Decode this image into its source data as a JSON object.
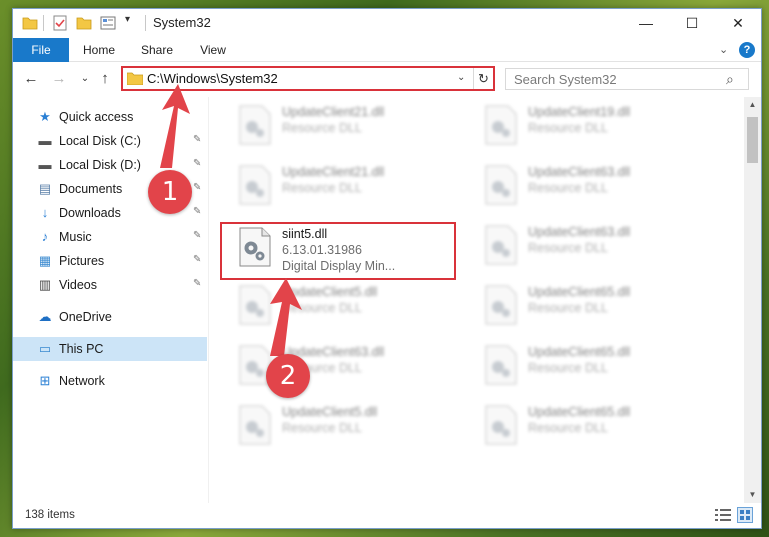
{
  "window": {
    "title": "System32",
    "quick_access_icons": [
      "folder-icon",
      "checklist-icon",
      "new-folder-icon",
      "properties-icon",
      "customize-arrow-icon"
    ],
    "controls": {
      "minimize": "—",
      "maximize": "☐",
      "close": "✕"
    }
  },
  "ribbon": {
    "tabs": [
      "File",
      "Home",
      "Share",
      "View"
    ],
    "expand": "⌄",
    "help": "?"
  },
  "nav": {
    "back": "←",
    "forward": "→",
    "recent": "⌄",
    "up": "↑"
  },
  "address": {
    "path": "C:\\Windows\\System32",
    "dropdown": "⌄",
    "refresh": "↻"
  },
  "search": {
    "placeholder": "Search System32",
    "icon": "⌕"
  },
  "sidebar": {
    "items": [
      {
        "label": "Quick access",
        "icon": "★",
        "pinned": false
      },
      {
        "label": "Local Disk (C:)",
        "icon": "▬",
        "pinned": true
      },
      {
        "label": "Local Disk (D:)",
        "icon": "▬",
        "pinned": true
      },
      {
        "label": "Documents",
        "icon": "▤",
        "pinned": true
      },
      {
        "label": "Downloads",
        "icon": "↓",
        "pinned": true
      },
      {
        "label": "Music",
        "icon": "♪",
        "pinned": true
      },
      {
        "label": "Pictures",
        "icon": "▦",
        "pinned": true
      },
      {
        "label": "Videos",
        "icon": "▥",
        "pinned": true
      },
      {
        "label": "OneDrive",
        "icon": "☁",
        "pinned": false
      },
      {
        "label": "This PC",
        "icon": "▭",
        "pinned": false
      },
      {
        "label": "Network",
        "icon": "⊞",
        "pinned": false
      }
    ],
    "pin_glyph": "✎"
  },
  "files": {
    "left_column": [
      {
        "name": "UpdateClient21.dll",
        "type": "Resource DLL"
      },
      {
        "name": "UpdateClient21.dll",
        "type": "Resource DLL"
      },
      {
        "name": "siint5.dll",
        "version": "6.13.01.31986",
        "description": "Digital Display Min..."
      },
      {
        "name": "UpdateClient5.dll",
        "type": "Resource DLL"
      },
      {
        "name": "UpdateClient63.dll",
        "type": "Resource DLL"
      },
      {
        "name": "UpdateClient5.dll",
        "type": "Resource DLL"
      }
    ],
    "right_column": [
      {
        "name": "UpdateClient19.dll",
        "type": "Resource DLL"
      },
      {
        "name": "UpdateClient63.dll",
        "type": "Resource DLL"
      },
      {
        "name": "UpdateClient63.dll",
        "type": "Resource DLL"
      },
      {
        "name": "UpdateClient65.dll",
        "type": "Resource DLL"
      },
      {
        "name": "UpdateClient65.dll",
        "type": "Resource DLL"
      },
      {
        "name": "UpdateClient65.dll",
        "type": "Resource DLL"
      }
    ]
  },
  "statusbar": {
    "count": "138 items"
  },
  "annotations": {
    "step1": "1",
    "step2": "2",
    "color": "#e2444a"
  }
}
